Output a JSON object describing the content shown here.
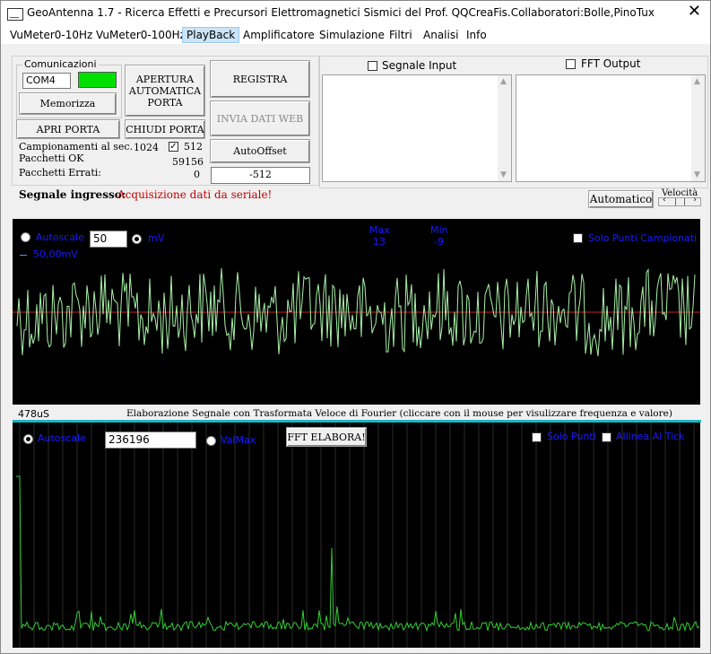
{
  "window": {
    "title": "GeoAntenna 1.7 - Ricerca Effetti e Precursori Elettromagnetici Sismici del Prof. QQCreaFis.Collaboratori:Bolle,PinoTux",
    "close": "✕"
  },
  "menu": [
    "VuMeter0-10Hz",
    "VuMeter0-100Hz",
    "PlayBack",
    "Amplificatore",
    "Simulazione",
    "Filtri",
    "Analisi",
    "Info"
  ],
  "comm": {
    "group_title": "Comunicazioni",
    "port_value": "COM4",
    "status_color": "#00e000",
    "memorizza": "Memorizza",
    "apri": "APRI PORTA",
    "apertura_line1": "APERTURA",
    "apertura_line2": "AUTOMATICA",
    "apertura_line3": "PORTA",
    "chiudi": "CHIUDI PORTA"
  },
  "stats": {
    "campionamenti_label": "Campionamenti al sec.",
    "campionamenti_value": "1024",
    "check_512": "512",
    "pacchetti_ok_label": "Pacchetti OK",
    "pacchetti_ok_value": "59156",
    "pacchetti_errati_label": "Pacchetti Errati:",
    "pacchetti_errati_value": "0"
  },
  "actions": {
    "registra": "REGISTRA",
    "invia": "INVIA DATI WEB",
    "autooffset": "AutoOffset",
    "offset_value": "-512"
  },
  "lists": {
    "segnale_input": "Segnale Input",
    "fft_output": "FFT Output"
  },
  "status": {
    "segnale_label": "Segnale ingresso:",
    "segnale_value": "Acquisizione dati da seriale!",
    "automatico": "Automatico",
    "velocita": "Velocità",
    "vel_left": "‹",
    "vel_right": "›"
  },
  "scope": {
    "autoscale": "Autoscale",
    "scale_value": "50",
    "unit": "mV",
    "scale_label": "50,00mV",
    "max_label": "Max",
    "max_value": "13",
    "min_label": "Min",
    "min_value": "-9",
    "solo_punti": "Solo Punti Campionati",
    "time_label": "478uS",
    "trace_color": "#a8f0a8",
    "baseline_color": "#cc2020"
  },
  "fft": {
    "caption": "Elaborazione Segnale con Trasformata Veloce di Fourier (cliccare con il mouse per visulizzare frequenza e valore)",
    "autoscale": "Autoscale",
    "scale_value": "236196",
    "valmax": "ValMax",
    "elabora": "FFT ELABORA!",
    "solo_punti": "Solo Punti",
    "allinea": "Allinea Al Tick",
    "trace_color": "#33cc33"
  }
}
